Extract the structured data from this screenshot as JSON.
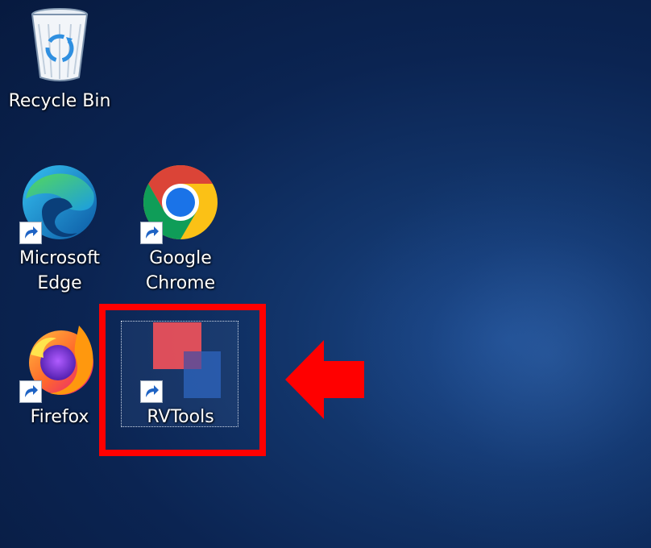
{
  "desktop": {
    "icons": [
      {
        "id": "recycle-bin",
        "label": "Recycle Bin",
        "icon": "recycle-bin-icon",
        "shortcut": false
      },
      {
        "id": "microsoft-edge",
        "label_lines": [
          "Microsoft",
          "Edge"
        ],
        "icon": "edge-icon",
        "shortcut": true
      },
      {
        "id": "google-chrome",
        "label_lines": [
          "Google",
          "Chrome"
        ],
        "icon": "chrome-icon",
        "shortcut": true
      },
      {
        "id": "firefox",
        "label": "Firefox",
        "icon": "firefox-icon",
        "shortcut": true
      },
      {
        "id": "rvtools",
        "label": "RVTools",
        "icon": "rvtools-icon",
        "shortcut": true,
        "selected": true
      }
    ]
  },
  "annotation": {
    "highlight_color": "#ff0000",
    "arrow_icon": "left-arrow-icon"
  },
  "colors": {
    "wallpaper": "#0b2452",
    "label_text": "#ffffff"
  }
}
